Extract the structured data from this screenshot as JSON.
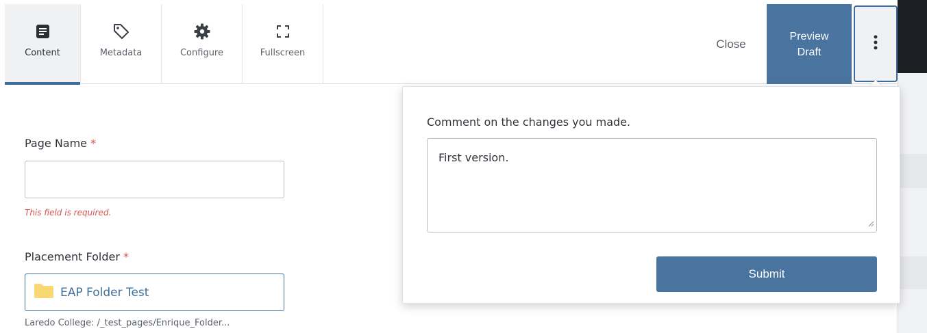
{
  "toolbar": {
    "tabs": [
      {
        "label": "Content",
        "icon": "content-doc-icon"
      },
      {
        "label": "Metadata",
        "icon": "tag-icon"
      },
      {
        "label": "Configure",
        "icon": "gear-icon"
      },
      {
        "label": "Fullscreen",
        "icon": "fullscreen-icon"
      }
    ],
    "close_label": "Close",
    "preview_line1": "Preview",
    "preview_line2": "Draft",
    "more_icon": "vertical-dots-icon"
  },
  "form": {
    "page_name_label": "Page Name",
    "required_marker": "*",
    "page_name_value": "",
    "page_name_error": "This field is required.",
    "placement_folder_label": "Placement Folder",
    "folder_name": "EAP Folder Test",
    "folder_path": "Laredo College: /_test_pages/Enrique_Folder..."
  },
  "popover": {
    "prompt": "Comment on the changes you made.",
    "comment_value": "First version.",
    "submit_label": "Submit"
  },
  "colors": {
    "accent": "#4a74a0",
    "error": "#d9534f",
    "folder": "#f8d775",
    "dark": "#1e1f24"
  }
}
